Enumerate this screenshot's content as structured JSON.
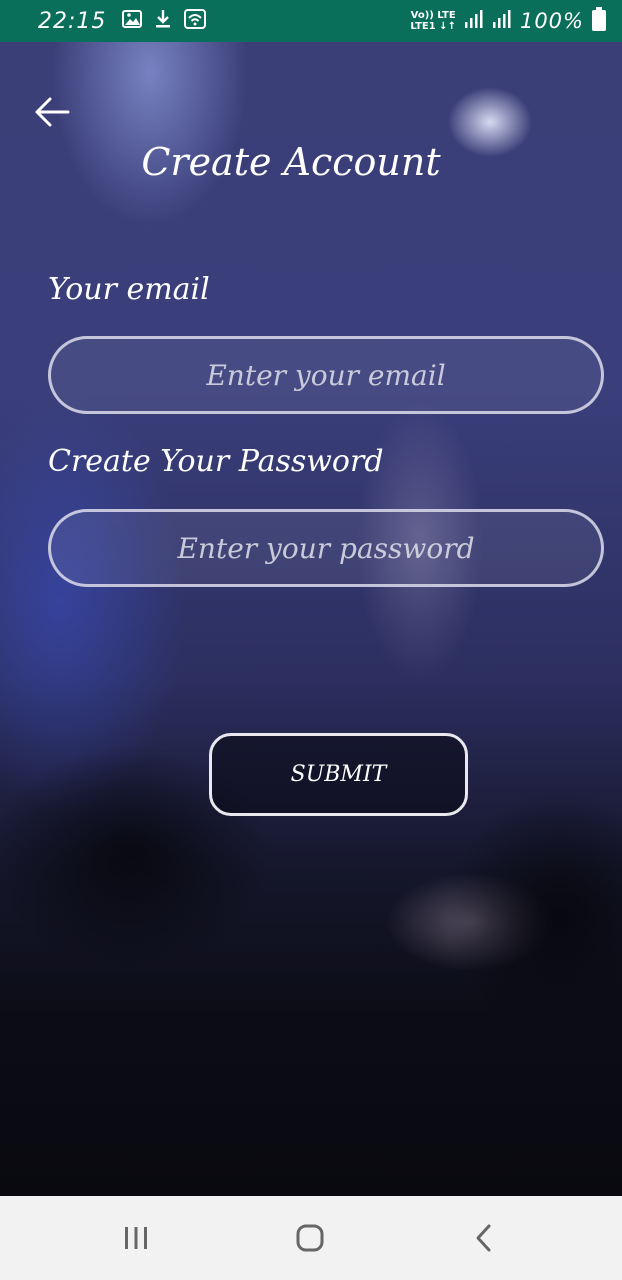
{
  "status_bar": {
    "time": "22:15",
    "network_top": "Vo)) LTE",
    "network_bottom": "LTE1 ↓↑",
    "battery_text": "100%",
    "icons": [
      "image-icon",
      "download-icon",
      "wifi-icon",
      "signal-icon",
      "signal-icon",
      "battery-icon"
    ]
  },
  "header": {
    "back_icon": "arrow-left-icon",
    "title": "Create Account"
  },
  "form": {
    "email_label": "Your email",
    "email_placeholder": "Enter your email",
    "email_value": "",
    "password_label": "Create Your Password",
    "password_placeholder": "Enter your password",
    "password_value": "",
    "submit_label": "SUBMIT"
  },
  "nav_bar": {
    "icons": [
      "recent-apps-icon",
      "home-icon",
      "back-icon"
    ]
  },
  "colors": {
    "status_bar": "#0a6f5a",
    "nav_bar": "#f2f2f2",
    "text": "#ffffff",
    "field_border": "#dcdceb"
  }
}
